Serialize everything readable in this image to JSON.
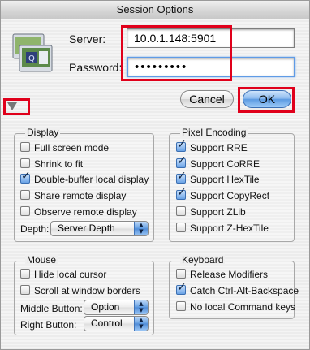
{
  "window": {
    "title": "Session Options"
  },
  "connection": {
    "server_label": "Server:",
    "server_value": "10.0.1.148:5901",
    "password_label": "Password:",
    "password_value": "•••••••••"
  },
  "buttons": {
    "cancel": "Cancel",
    "ok": "OK"
  },
  "display": {
    "title": "Display",
    "options": [
      {
        "label": "Full screen mode",
        "checked": false
      },
      {
        "label": "Shrink to fit",
        "checked": false
      },
      {
        "label": "Double-buffer local display",
        "checked": true
      },
      {
        "label": "Share remote display",
        "checked": false
      },
      {
        "label": "Observe remote display",
        "checked": false
      }
    ],
    "depth_label": "Depth:",
    "depth_value": "Server Depth"
  },
  "pixel_encoding": {
    "title": "Pixel Encoding",
    "options": [
      {
        "label": "Support RRE",
        "checked": true
      },
      {
        "label": "Support CoRRE",
        "checked": true
      },
      {
        "label": "Support HexTile",
        "checked": true
      },
      {
        "label": "Support CopyRect",
        "checked": true
      },
      {
        "label": "Support ZLib",
        "checked": false
      },
      {
        "label": "Support Z-HexTile",
        "checked": false
      }
    ]
  },
  "mouse": {
    "title": "Mouse",
    "options": [
      {
        "label": "Hide local cursor",
        "checked": false
      },
      {
        "label": "Scroll at window borders",
        "checked": false
      }
    ],
    "middle_button_label": "Middle Button:",
    "middle_button_value": "Option",
    "right_button_label": "Right Button:",
    "right_button_value": "Control"
  },
  "keyboard": {
    "title": "Keyboard",
    "options": [
      {
        "label": "Release Modifiers",
        "checked": false
      },
      {
        "label": "Catch Ctrl-Alt-Backspace",
        "checked": true
      },
      {
        "label": "No local Command keys",
        "checked": false
      }
    ]
  },
  "colors": {
    "highlight_box": "#e0001b",
    "focus_ring": "#5f9be6",
    "accent": "#5c9ae2"
  }
}
